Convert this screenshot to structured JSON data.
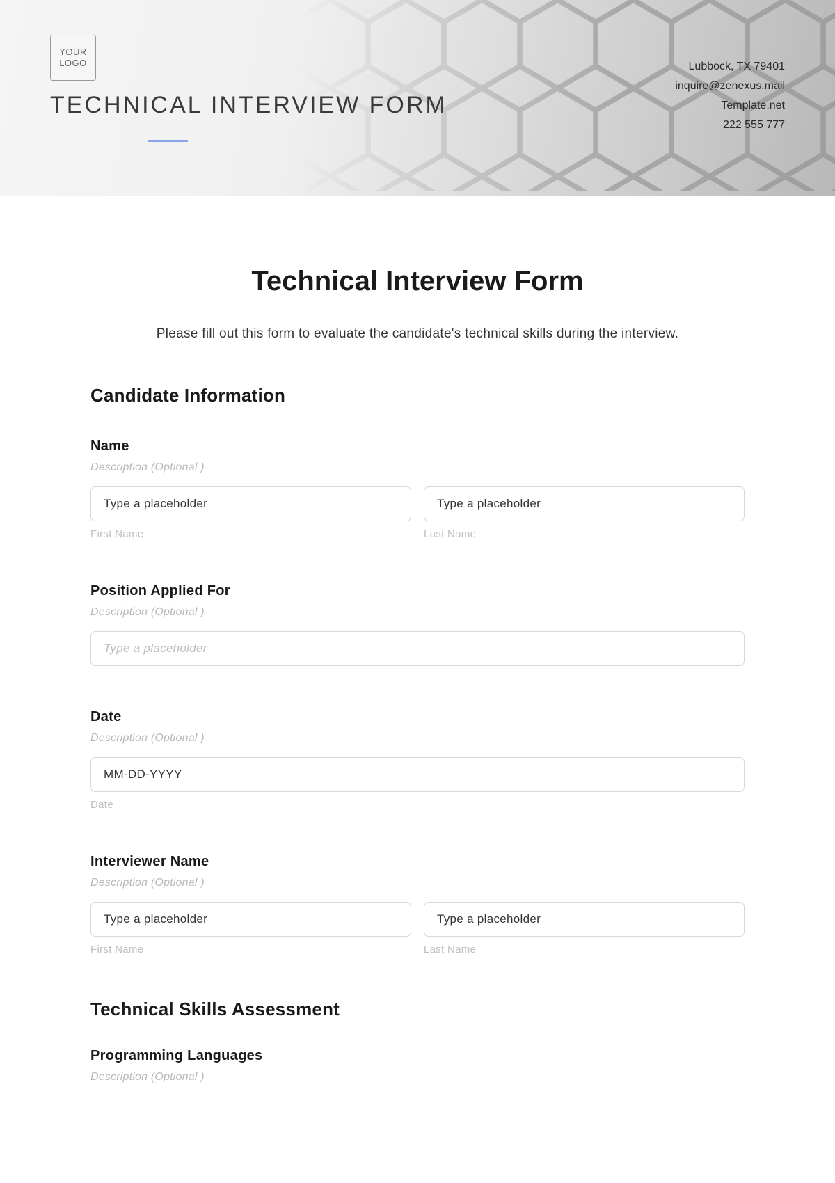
{
  "banner": {
    "logo_text": "YOUR\nLOGO",
    "title": "TECHNICAL INTERVIEW FORM",
    "contact": {
      "address": "Lubbock, TX 79401",
      "email": "inquire@zenexus.mail",
      "site": "Template.net",
      "phone": "222 555 777"
    }
  },
  "page": {
    "title": "Technical Interview Form",
    "intro": "Please fill out this form to evaluate the candidate's technical skills during the interview."
  },
  "sections": {
    "candidate": {
      "heading": "Candidate Information",
      "name": {
        "label": "Name",
        "desc": "Description (Optional )",
        "first_placeholder": "Type a placeholder",
        "first_sub": "First Name",
        "last_placeholder": "Type a placeholder",
        "last_sub": "Last Name"
      },
      "position": {
        "label": "Position Applied For",
        "desc": "Description (Optional )",
        "placeholder": "Type a placeholder"
      },
      "date": {
        "label": "Date",
        "desc": "Description (Optional )",
        "placeholder": "MM-DD-YYYY",
        "sub": "Date"
      },
      "interviewer": {
        "label": "Interviewer Name",
        "desc": "Description (Optional )",
        "first_placeholder": "Type a placeholder",
        "first_sub": "First Name",
        "last_placeholder": "Type a placeholder",
        "last_sub": "Last Name"
      }
    },
    "skills": {
      "heading": "Technical Skills Assessment",
      "programming": {
        "label": "Programming Languages",
        "desc": "Description (Optional )"
      }
    }
  }
}
